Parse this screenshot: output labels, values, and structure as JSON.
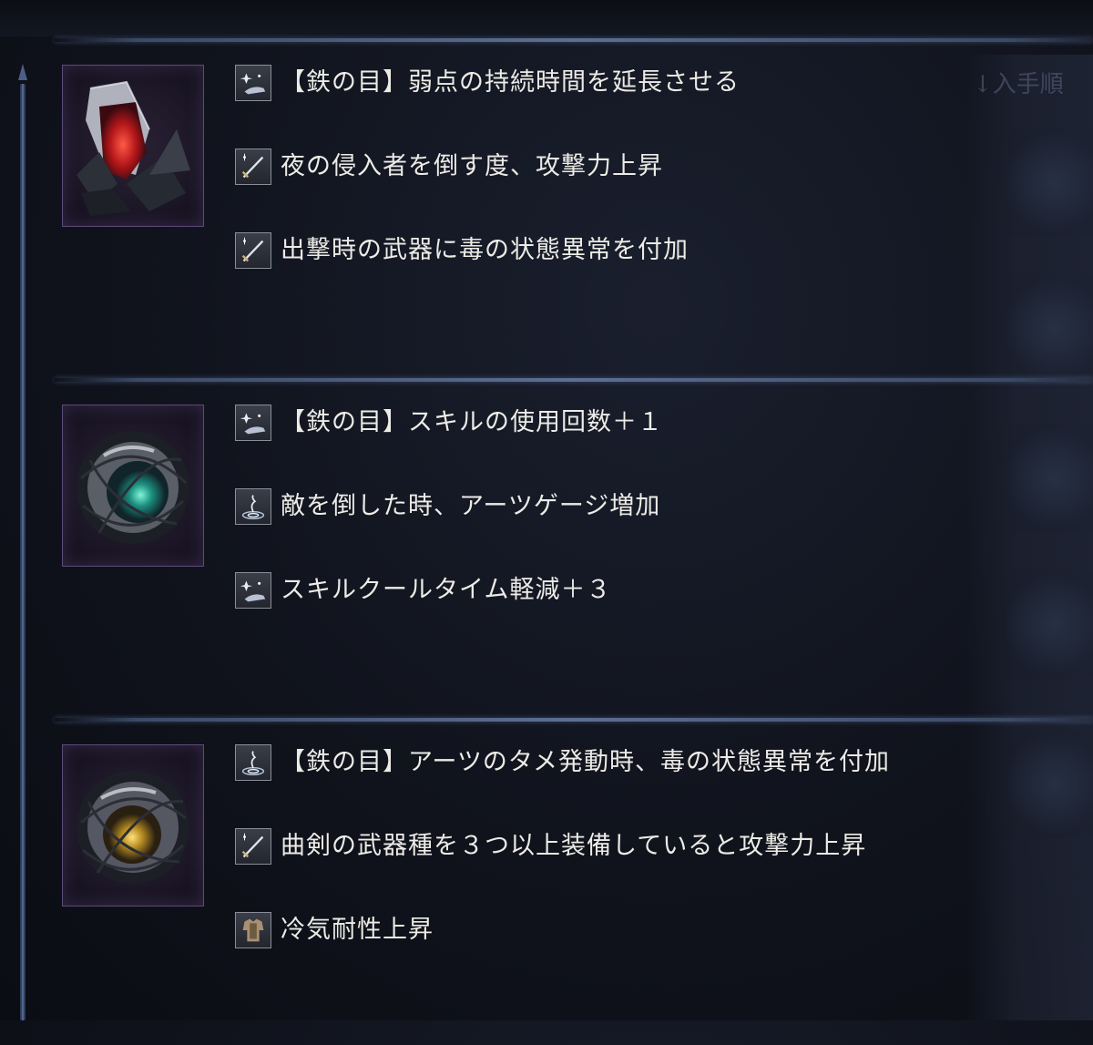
{
  "sort_label": "↓入手順",
  "relics": [
    {
      "gem": "red-crystal",
      "gem_color": "#e0302a",
      "effects": [
        {
          "icon": "skill-spark-icon",
          "text": "【鉄の目】弱点の持続時間を延長させる"
        },
        {
          "icon": "sword-icon",
          "text": "夜の侵入者を倒す度、攻撃力上昇"
        },
        {
          "icon": "sword-icon",
          "text": "出撃時の武器に毒の状態異常を付加"
        }
      ]
    },
    {
      "gem": "teal-orb",
      "gem_color": "#2fd0b0",
      "effects": [
        {
          "icon": "skill-spark-icon",
          "text": "【鉄の目】スキルの使用回数＋１"
        },
        {
          "icon": "arts-ripple-icon",
          "text": "敵を倒した時、アーツゲージ増加"
        },
        {
          "icon": "skill-spark-icon",
          "text": "スキルクールタイム軽減＋３"
        }
      ]
    },
    {
      "gem": "yellow-orb",
      "gem_color": "#e8c040",
      "effects": [
        {
          "icon": "arts-ripple-icon",
          "text": "【鉄の目】アーツのタメ発動時、毒の状態異常を付加"
        },
        {
          "icon": "sword-icon",
          "text": "曲剣の武器種を３つ以上装備していると攻撃力上昇"
        },
        {
          "icon": "armor-icon",
          "text": "冷気耐性上昇"
        }
      ]
    }
  ]
}
